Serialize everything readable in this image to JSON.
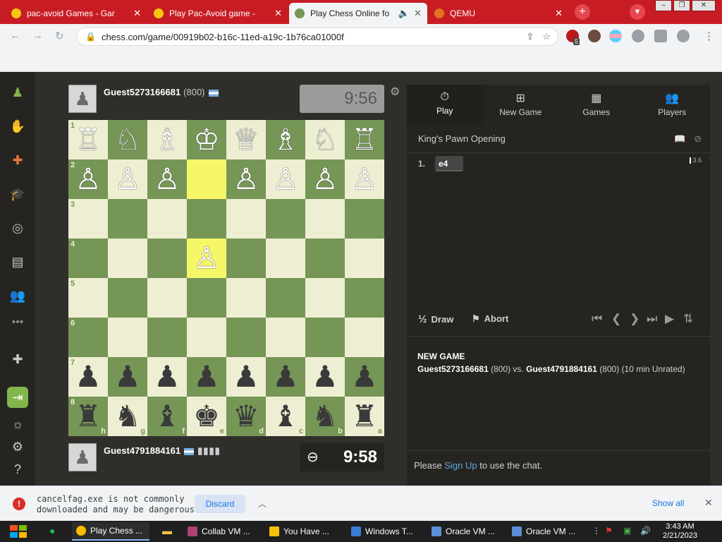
{
  "browser": {
    "tabs": [
      {
        "title": "pac-avoid Games - Gar",
        "active": false
      },
      {
        "title": "Play Pac-Avoid game -",
        "active": false
      },
      {
        "title": "Play Chess Online fo",
        "active": true
      },
      {
        "title": "QEMU",
        "active": false
      }
    ],
    "url": "chess.com/game/00919b02-b16c-11ed-a19c-1b76ca01000f",
    "extension_badge": "5"
  },
  "game": {
    "top_player": {
      "name": "Guest5273166681",
      "rating": "(800)",
      "clock": "9:56"
    },
    "bottom_player": {
      "name": "Guest4791884161",
      "clock": "9:58"
    },
    "board": {
      "ranks": [
        "1",
        "2",
        "3",
        "4",
        "5",
        "6",
        "7",
        "8"
      ],
      "files": [
        "h",
        "g",
        "f",
        "e",
        "d",
        "c",
        "b",
        "a"
      ],
      "rows": [
        [
          "♖",
          "♘",
          "♗",
          "♔",
          "♕",
          "♗",
          "♘",
          "♖"
        ],
        [
          "♙",
          "♙",
          "♙",
          "",
          "♙",
          "♙",
          "♙",
          "♙"
        ],
        [
          "",
          "",
          "",
          "",
          "",
          "",
          "",
          ""
        ],
        [
          "",
          "",
          "",
          "♙",
          "",
          "",
          "",
          ""
        ],
        [
          "",
          "",
          "",
          "",
          "",
          "",
          "",
          ""
        ],
        [
          "",
          "",
          "",
          "",
          "",
          "",
          "",
          ""
        ],
        [
          "♟",
          "♟",
          "♟",
          "♟",
          "♟",
          "♟",
          "♟",
          "♟"
        ],
        [
          "♜",
          "♞",
          "♝",
          "♚",
          "♛",
          "♝",
          "♞",
          "♜"
        ]
      ],
      "colors": [
        [
          "w",
          "w",
          "w",
          "w",
          "w",
          "w",
          "w",
          "w"
        ],
        [
          "w",
          "w",
          "w",
          "",
          "w",
          "w",
          "w",
          "w"
        ],
        [
          "",
          "",
          "",
          "",
          "",
          "",
          "",
          ""
        ],
        [
          "",
          "",
          "",
          "w",
          "",
          "",
          "",
          ""
        ],
        [
          "",
          "",
          "",
          "",
          "",
          "",
          "",
          ""
        ],
        [
          "",
          "",
          "",
          "",
          "",
          "",
          "",
          ""
        ],
        [
          "b",
          "b",
          "b",
          "b",
          "b",
          "b",
          "b",
          "b"
        ],
        [
          "b",
          "b",
          "b",
          "b",
          "b",
          "b",
          "b",
          "b"
        ]
      ],
      "highlighted": [
        "1,3",
        "3,3"
      ]
    }
  },
  "panel": {
    "tabs": [
      {
        "label": "Play",
        "icon": "stopwatch-icon",
        "active": true
      },
      {
        "label": "New Game",
        "icon": "plus-square-icon",
        "active": false
      },
      {
        "label": "Games",
        "icon": "checkerboard-icon",
        "active": false
      },
      {
        "label": "Players",
        "icon": "players-icon",
        "active": false
      }
    ],
    "opening": "King's Pawn Opening",
    "move_number": "1.",
    "move": "e4",
    "eval": "3.6",
    "draw_label": "Draw",
    "draw_glyph": "½",
    "abort_label": "Abort",
    "info_heading": "NEW GAME",
    "info_white": "Guest5273166681",
    "info_white_rating": " (800) vs. ",
    "info_black": "Guest4791884161",
    "info_tail": " (800) (10 min Unrated)",
    "chat_prefix": "Please ",
    "chat_link": "Sign Up",
    "chat_suffix": " to use the chat."
  },
  "download": {
    "line1": "cancelfag.exe is not commonly",
    "line2": "downloaded and may be dangerous.",
    "discard_label": "Discard",
    "show_all_label": "Show all"
  },
  "taskbar": {
    "items": [
      "Play Chess ...",
      "Collab VM ...",
      "You Have ...",
      "Windows T...",
      "Oracle VM ...",
      "Oracle VM ..."
    ],
    "time": "3:43 AM",
    "date": "2/21/2023"
  },
  "colors": {
    "accent": "#c81c24",
    "board_light": "#eeeed2",
    "board_dark": "#769656",
    "highlight": "#f6f669",
    "link": "#5fa7e0"
  }
}
